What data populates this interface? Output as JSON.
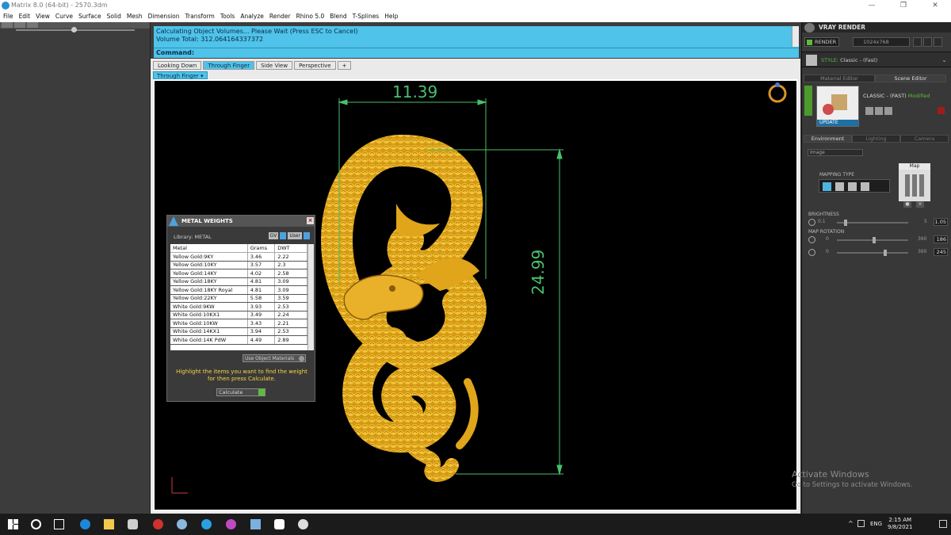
{
  "window": {
    "title": "Matrix 8.0 (64-bit) - 2570.3dm",
    "controls": [
      "—",
      "❐",
      "✕"
    ]
  },
  "menu": [
    "File",
    "Edit",
    "View",
    "Curve",
    "Surface",
    "Solid",
    "Mesh",
    "Dimension",
    "Transform",
    "Tools",
    "Analyze",
    "Render",
    "Rhino 5.0",
    "Blend",
    "T-Splines",
    "Help"
  ],
  "command": {
    "line1": "Calculating Object Volumes... Please Wait (Press ESC to Cancel)",
    "line2": "Volume Total: 312.064164337372",
    "prompt": "Command:"
  },
  "viewport_tabs": [
    "Looking Down",
    "Through Finger",
    "Side View",
    "Perspective",
    "+"
  ],
  "active_view": "Through Finger",
  "dimensions": {
    "width": "11.39",
    "height": "24.99"
  },
  "metal_weights": {
    "title": "METAL WEIGHTS",
    "library_label": "Library: METAL",
    "lib_buttons": [
      "GV",
      "User"
    ],
    "columns": [
      "Metal",
      "Grams",
      "DWT"
    ],
    "rows": [
      [
        "Yellow Gold:9KY",
        "3.46",
        "2.22"
      ],
      [
        "Yellow Gold:10KY",
        "3.57",
        "2.3"
      ],
      [
        "Yellow Gold:14KY",
        "4.02",
        "2.58"
      ],
      [
        "Yellow Gold:18KY",
        "4.81",
        "3.09"
      ],
      [
        "Yellow Gold:18KY Royal",
        "4.81",
        "3.09"
      ],
      [
        "Yellow Gold:22KY",
        "5.58",
        "3.59"
      ],
      [
        "White Gold:9KW",
        "3.93",
        "2.53"
      ],
      [
        "White Gold:10KX1",
        "3.49",
        "2.24"
      ],
      [
        "White Gold:10KW",
        "3.43",
        "2.21"
      ],
      [
        "White Gold:14KX1",
        "3.94",
        "2.53"
      ],
      [
        "White Gold:14K PdW",
        "4.49",
        "2.89"
      ]
    ],
    "use_object_materials": "Use Object Materials",
    "hint": "Highlight the items you want to find the weight for then press Calculate.",
    "calculate": "Calculate"
  },
  "vray": {
    "title": "VRAY RENDER",
    "render_btn": "RENDER",
    "resolution": "1024x768",
    "style_prefix": "STYLE:",
    "style": "Classic - (Fast)",
    "tabs": [
      "Material Editor",
      "Scene Editor"
    ],
    "update": "UPDATE",
    "class_name": "CLASSIC - (FAST)",
    "modified": "Modified",
    "env_tabs": [
      "Environment",
      "Lighting",
      "Camera"
    ],
    "image_select": "Image",
    "mapping_type": "MAPPING TYPE",
    "map_label": "Map",
    "brightness": {
      "label": "BRIGHTNESS",
      "min": "0.1",
      "max": "5",
      "value": "1.05",
      "level": 0.12
    },
    "map_rotation": {
      "label": "MAP ROTATION",
      "rows": [
        {
          "min": "0",
          "max": "360",
          "value": "186",
          "level": 0.52
        },
        {
          "min": "0",
          "max": "360",
          "value": "245",
          "level": 0.68
        }
      ]
    }
  },
  "watermark": {
    "line1": "Activate Windows",
    "line2": "Go to Settings to activate Windows."
  },
  "taskbar": {
    "time": "2:15 AM",
    "date": "9/8/2021",
    "lang": "ENG"
  },
  "colors": {
    "accent": "#4fc3e9",
    "gold": "#e8b421",
    "dimension": "#49c06b",
    "render_green": "#5bbd3b"
  }
}
